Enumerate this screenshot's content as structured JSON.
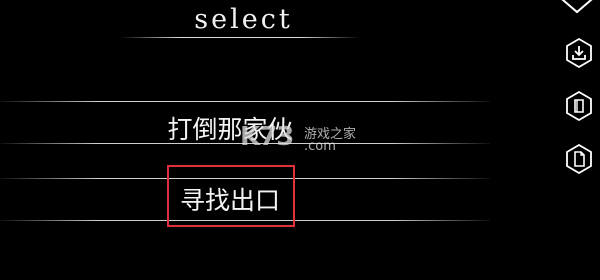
{
  "screen": {
    "title": "select"
  },
  "choices": [
    {
      "label": "打倒那家伙"
    },
    {
      "label": "寻找出口"
    }
  ],
  "watermark": {
    "logo": "K73",
    "text": "游戏之家",
    "domain": ".com"
  },
  "side_menu": {
    "icons": [
      "diamond-icon",
      "download-icon",
      "book-icon",
      "document-icon"
    ]
  },
  "colors": {
    "background": "#000000",
    "text": "#f4f4f4",
    "highlight": "#e0313a"
  }
}
